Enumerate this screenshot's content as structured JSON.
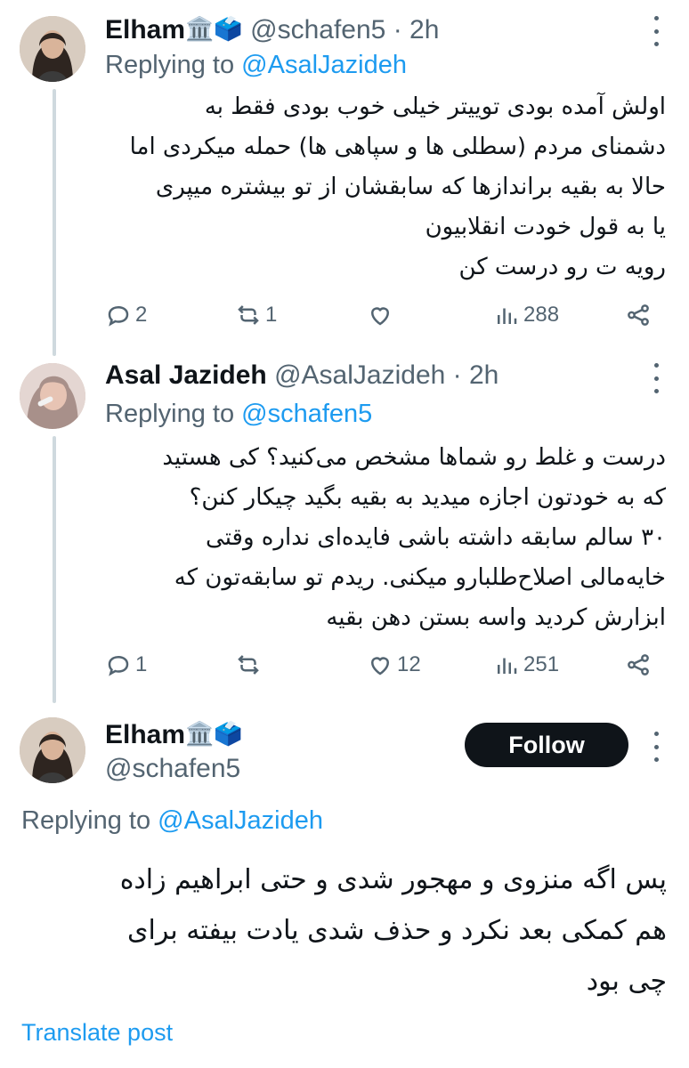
{
  "tweets": [
    {
      "name": "Elham",
      "emoji": "🏛️🗳️",
      "handle": "@schafen5",
      "time": "· 2h",
      "replying_prefix": "Replying to",
      "replying_handle": "@AsalJazideh",
      "text": "اولش آمده بودی توییتر خیلی خوب بودی فقط به\nدشمنای مردم (سطلی ها و سپاهی ها) حمله میکردی اما\nحالا به  بقیه براندازها که سابقشان از تو بیشتره میپری\nیا به قول خودت انقلابیون\nرویه ت رو درست کن",
      "replies": "2",
      "reposts": "1",
      "likes": "",
      "views": "288"
    },
    {
      "name": "Asal Jazideh",
      "handle": "@AsalJazideh",
      "time": "· 2h",
      "replying_prefix": "Replying to",
      "replying_handle": "@schafen5",
      "text": "درست و غلط رو شماها مشخص می‌کنید؟ کی هستید\nکه به خودتون اجازه میدید به بقیه بگید چیکار کنن؟\n۳۰ سالم سابقه داشته باشی فایده‌ای نداره وقتی\nخایه‌مالی اصلاح‌طلبارو میکنی. ریدم تو سابقه‌تون که\nابزارش کردید واسه بستن دهن بقیه",
      "replies": "1",
      "reposts": "",
      "likes": "12",
      "views": "251"
    },
    {
      "name": "Elham",
      "emoji": "🏛️🗳️",
      "handle": "@schafen5",
      "follow_label": "Follow",
      "replying_prefix": "Replying to",
      "replying_handle": "@AsalJazideh",
      "text": "پس اگه منزوی و مهجور شدی و حتی ابراهیم زاده\nهم کمکی بعد نکرد و حذف شدی یادت بیفته برای\nچی بود",
      "translate_label": "Translate post"
    }
  ],
  "colors": {
    "link": "#1d9bf0",
    "secondary_text": "#536471",
    "thread_line": "#cfd9de",
    "follow_bg": "#0f1419"
  },
  "icons": [
    "reply-icon",
    "repost-icon",
    "like-icon",
    "views-icon",
    "share-icon",
    "more-icon"
  ]
}
